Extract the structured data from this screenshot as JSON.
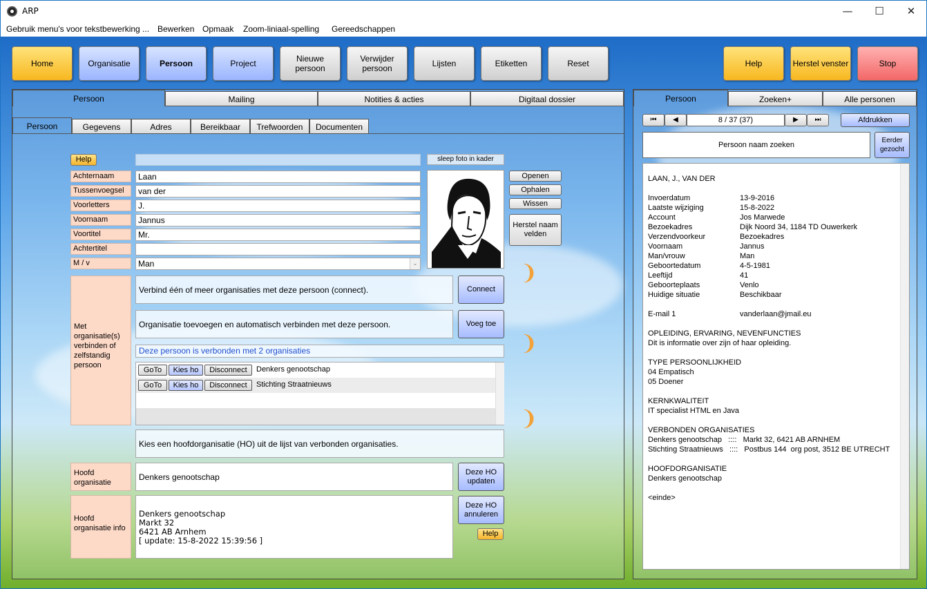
{
  "window": {
    "title": "ARP",
    "minimize": "—",
    "maximize": "☐",
    "close": "✕"
  },
  "menu": [
    "Gebruik menu's voor tekstbewerking ...",
    "Bewerken",
    "Opmaak",
    "Zoom-liniaal-spelling",
    "Gereedschappen"
  ],
  "toolbar": {
    "home": "Home",
    "organisatie": "Organisatie",
    "persoon": "Persoon",
    "project": "Project",
    "nieuwe_persoon": "Nieuwe persoon",
    "verwijder_persoon": "Verwijder persoon",
    "lijsten": "Lijsten",
    "etiketten": "Etiketten",
    "reset": "Reset",
    "help": "Help",
    "herstel_venster": "Herstel venster",
    "stop": "Stop"
  },
  "main_tabs": [
    "Persoon",
    "Mailing",
    "Notities & acties",
    "Digitaal dossier"
  ],
  "sub_tabs": [
    "Persoon",
    "Gegevens",
    "Adres",
    "Bereikbaar",
    "Trefwoorden",
    "Documenten"
  ],
  "form": {
    "help": "Help",
    "photo_hint": "sleep foto in kader",
    "fields": [
      {
        "label": "Achternaam",
        "value": "Laan"
      },
      {
        "label": "Tussenvoegsel",
        "value": "van der"
      },
      {
        "label": "Voorletters",
        "value": "J."
      },
      {
        "label": "Voornaam",
        "value": "Jannus"
      },
      {
        "label": "Voortitel",
        "value": "Mr."
      },
      {
        "label": "Achtertitel",
        "value": ""
      },
      {
        "label": "M / v",
        "value": "Man"
      }
    ],
    "photo_buttons": {
      "openen": "Openen",
      "ophalen": "Ophalen",
      "wissen": "Wissen",
      "herstel": "Herstel naam velden"
    }
  },
  "org": {
    "side_label": "Met organisatie(s) verbinden of zelfstandig persoon",
    "connect_text": "Verbind één of meer organisaties met deze persoon (connect).",
    "connect_btn": "Connect",
    "add_text": "Organisatie toevoegen en automatisch verbinden met deze persoon.",
    "add_btn": "Voeg toe",
    "linked_count": "Deze persoon is verbonden met 2 organisaties",
    "row_buttons": {
      "goto": "GoTo",
      "kies": "Kies ho",
      "disconnect": "Disconnect"
    },
    "rows": [
      "Denkers genootschap",
      "Stichting Straatnieuws"
    ],
    "choose_text": "Kies een hoofdorganisatie (HO) uit de lijst van verbonden organisaties.",
    "hoofd_label": "Hoofd organisatie",
    "hoofd_value": "Denkers genootschap",
    "update_btn": "Deze HO updaten",
    "info_label": "Hoofd organisatie info",
    "info_lines": [
      "Denkers genootschap",
      "Markt 32",
      "6421 AB Arnhem",
      "[ update: 15-8-2022 15:39:56 ]"
    ],
    "cancel_btn": "Deze HO annuleren",
    "help": "Help"
  },
  "right": {
    "tabs": [
      "Persoon",
      "Zoeken+",
      "Alle personen"
    ],
    "nav": {
      "first": "⏮",
      "prev": "◀",
      "position": "8 / 37 (37)",
      "next": "▶",
      "last": "⏭"
    },
    "print": "Afdrukken",
    "search": "Persoon naam zoeken",
    "earlier": "Eerder gezocht",
    "heading": "LAAN, J., VAN DER",
    "details": [
      {
        "k": "Invoerdatum",
        "v": "13-9-2016"
      },
      {
        "k": "Laatste wijziging",
        "v": "15-8-2022"
      },
      {
        "k": "Account",
        "v": "Jos Marwede"
      },
      {
        "k": "Bezoekadres",
        "v": "Dijk Noord 34, 1184 TD Ouwerkerk"
      },
      {
        "k": "Verzendvoorkeur",
        "v": "Bezoekadres"
      },
      {
        "k": "Voornaam",
        "v": "Jannus"
      },
      {
        "k": "Man/vrouw",
        "v": "Man"
      },
      {
        "k": "Geboortedatum",
        "v": "4-5-1981"
      },
      {
        "k": "Leeftijd",
        "v": "41"
      },
      {
        "k": "Geboorteplaats",
        "v": "Venlo"
      },
      {
        "k": "Huidige situatie",
        "v": "Beschikbaar"
      }
    ],
    "email_k": "E-mail 1",
    "email_v": "vanderlaan@jmail.eu",
    "sections": [
      {
        "title": "OPLEIDING, ERVARING, NEVENFUNCTIES",
        "lines": [
          "Dit is informatie over zijn of haar opleiding."
        ]
      },
      {
        "title": "TYPE PERSOONLIJKHEID",
        "lines": [
          "04 Empatisch",
          "05 Doener"
        ]
      },
      {
        "title": "KERNKWALITEIT",
        "lines": [
          "IT specialist HTML en Java"
        ]
      },
      {
        "title": "VERBONDEN ORGANISATIES",
        "lines": [
          "Denkers genootschap   ::::   Markt 32, 6421 AB ARNHEM",
          "Stichting Straatnieuws   ::::   Postbus 144  org post, 3512 BE UTRECHT"
        ]
      },
      {
        "title": "HOOFDORGANISATIE",
        "lines": [
          "Denkers genootschap"
        ]
      }
    ],
    "end": "<einde>"
  }
}
